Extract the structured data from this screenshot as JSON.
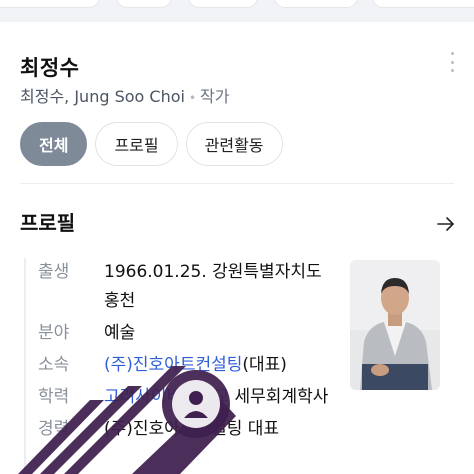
{
  "profile": {
    "name": "최정수",
    "aliases": "최정수, Jung Soo Choi",
    "job": "작가"
  },
  "tabs": [
    {
      "label": "전체",
      "active": true
    },
    {
      "label": "프로필",
      "active": false
    },
    {
      "label": "관련활동",
      "active": false
    }
  ],
  "section": {
    "title": "프로필"
  },
  "details": [
    {
      "label": "출생",
      "value": "1966.01.25. 강원특별자치도 홍천"
    },
    {
      "label": "분야",
      "value": "예술"
    },
    {
      "label": "소속",
      "value_link": "(주)진호아트컨설팅",
      "value_suffix": "(대표)"
    },
    {
      "label": "학력",
      "value_link": "고려사이버대학교",
      "value_suffix": " 세무회계학사"
    },
    {
      "label": "경력",
      "value": "(주)진호아트컨설팅 대표"
    }
  ],
  "colors": {
    "accent_link": "#2f5fd6",
    "active_tab": "#7f8a99",
    "watermark": "#3f1f4f"
  },
  "icons": [
    "more-vertical-icon",
    "arrow-right-icon",
    "watermark-logo"
  ]
}
